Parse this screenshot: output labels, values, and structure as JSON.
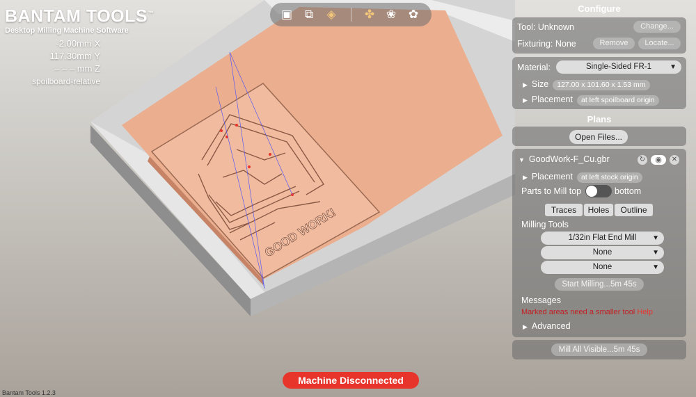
{
  "app": {
    "brand_title": "BANTAM TOOLS",
    "brand_tm": "™",
    "brand_subtitle": "Desktop Milling Machine Software",
    "version": "Bantam Tools 1.2.3"
  },
  "coords": {
    "x": "-2.00mm X",
    "y": "117.30mm Y",
    "z": "– – – mm Z",
    "mode": "spoilboard-relative"
  },
  "toolbar": {
    "icons": [
      "front-view-icon",
      "top-view-icon",
      "iso-view-icon",
      "layers-icon",
      "traces-icon",
      "drill-icon"
    ]
  },
  "configure": {
    "title": "Configure",
    "tool_label": "Tool: Unknown",
    "change_btn": "Change...",
    "fixturing_label": "Fixturing: None",
    "remove_btn": "Remove",
    "locate_btn": "Locate...",
    "material_label": "Material:",
    "material_value": "Single-Sided FR-1",
    "size_label": "Size",
    "size_value": "127.00 x 101.60 x 1.53 mm",
    "placement_label": "Placement",
    "placement_value": "at left spoilboard origin"
  },
  "plans": {
    "title": "Plans",
    "open_files_btn": "Open Files...",
    "file_name": "GoodWork-F_Cu.gbr",
    "placement_label": "Placement",
    "placement_value": "at left stock origin",
    "parts_label": "Parts to Mill top",
    "parts_bottom": "bottom",
    "tabs": [
      "Traces",
      "Holes",
      "Outline"
    ],
    "milling_tools_label": "Milling Tools",
    "tool1": "1/32in Flat End Mill",
    "tool2": "None",
    "tool3": "None",
    "start_btn": "Start Milling...5m 45s",
    "messages_label": "Messages",
    "message_text": "Marked areas need a smaller tool",
    "help_link": "Help",
    "advanced_label": "Advanced",
    "mill_all_btn": "Mill All Visible...5m 45s"
  },
  "status": {
    "text": "Machine Disconnected",
    "color": "#e8352c"
  },
  "colors": {
    "copper": "#e9a07f",
    "board_edge": "#c9c9c9",
    "accent_red": "#e8352c"
  }
}
